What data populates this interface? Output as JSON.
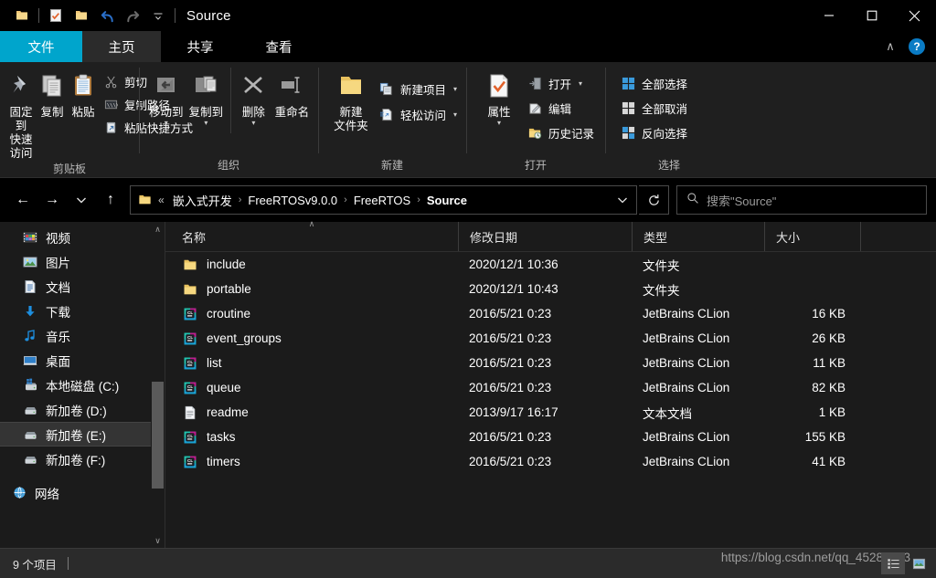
{
  "window": {
    "title": "Source",
    "quick_access": [
      "folder-icon",
      "properties-icon",
      "new-folder-icon",
      "undo-icon",
      "redo-icon",
      "customize-icon"
    ],
    "controls": {
      "minimize": "—",
      "maximize": "□",
      "close": "✕"
    }
  },
  "tabs": [
    {
      "label": "文件",
      "name": "tab-file",
      "state": "file-menu"
    },
    {
      "label": "主页",
      "name": "tab-home",
      "state": "active"
    },
    {
      "label": "共享",
      "name": "tab-share",
      "state": "normal"
    },
    {
      "label": "查看",
      "name": "tab-view",
      "state": "normal"
    }
  ],
  "tab_right": {
    "collapse_ribbon": "∧",
    "help": "?"
  },
  "ribbon": {
    "groups": [
      {
        "title": "剪贴板",
        "big_buttons": [
          {
            "label_line1": "固定到",
            "label_line2": "快速访问",
            "icon": "pin-icon"
          },
          {
            "label_line1": "复制",
            "label_line2": "",
            "icon": "copy-icon"
          },
          {
            "label_line1": "粘贴",
            "label_line2": "",
            "icon": "paste-icon"
          }
        ],
        "small_buttons": [
          {
            "label": "剪切",
            "icon": "scissors-icon"
          },
          {
            "label": "复制路径",
            "icon": "copy-path-icon"
          },
          {
            "label": "粘贴快捷方式",
            "icon": "paste-shortcut-icon"
          }
        ]
      },
      {
        "title": "组织",
        "big_buttons": [
          {
            "label_line1": "移动到",
            "label_line2": "",
            "icon": "move-to-icon",
            "has_caret": true
          },
          {
            "label_line1": "复制到",
            "label_line2": "",
            "icon": "copy-to-icon",
            "has_caret": true
          },
          {
            "label_line1": "删除",
            "label_line2": "",
            "icon": "delete-icon",
            "has_caret": true
          },
          {
            "label_line1": "重命名",
            "label_line2": "",
            "icon": "rename-icon"
          }
        ],
        "small_buttons": []
      },
      {
        "title": "新建",
        "big_buttons": [
          {
            "label_line1": "新建",
            "label_line2": "文件夹",
            "icon": "new-folder-icon"
          }
        ],
        "small_buttons": [
          {
            "label": "新建项目",
            "icon": "new-item-icon",
            "has_caret": true
          },
          {
            "label": "轻松访问",
            "icon": "easy-access-icon",
            "has_caret": true
          }
        ]
      },
      {
        "title": "打开",
        "big_buttons": [
          {
            "label_line1": "属性",
            "label_line2": "",
            "icon": "properties-icon",
            "has_caret": true
          }
        ],
        "small_buttons": [
          {
            "label": "打开",
            "icon": "open-icon",
            "has_caret": true
          },
          {
            "label": "编辑",
            "icon": "edit-icon"
          },
          {
            "label": "历史记录",
            "icon": "history-icon"
          }
        ]
      },
      {
        "title": "选择",
        "big_buttons": [],
        "small_buttons": [
          {
            "label": "全部选择",
            "icon": "select-all-icon"
          },
          {
            "label": "全部取消",
            "icon": "select-none-icon"
          },
          {
            "label": "反向选择",
            "icon": "invert-selection-icon"
          }
        ]
      }
    ]
  },
  "address_bar": {
    "back": "←",
    "forward": "→",
    "recent": "⌄",
    "up": "↑",
    "breadcrumb_overflow": "«",
    "breadcrumbs": [
      "嵌入式开发",
      "FreeRTOSv9.0.0",
      "FreeRTOS",
      "Source"
    ],
    "separator": "›",
    "dropdown": "⌄",
    "refresh": "↻",
    "search_placeholder": "搜索\"Source\""
  },
  "sidebar": {
    "items": [
      {
        "label": "视频",
        "icon": "videos-icon",
        "indent": 1,
        "selected": false
      },
      {
        "label": "图片",
        "icon": "pictures-icon",
        "indent": 1,
        "selected": false
      },
      {
        "label": "文档",
        "icon": "documents-icon",
        "indent": 1,
        "selected": false
      },
      {
        "label": "下载",
        "icon": "downloads-icon",
        "indent": 1,
        "selected": false
      },
      {
        "label": "音乐",
        "icon": "music-icon",
        "indent": 1,
        "selected": false
      },
      {
        "label": "桌面",
        "icon": "desktop-icon",
        "indent": 1,
        "selected": false
      },
      {
        "label": "本地磁盘 (C:)",
        "icon": "system-drive-icon",
        "indent": 1,
        "selected": false
      },
      {
        "label": "新加卷 (D:)",
        "icon": "drive-icon",
        "indent": 1,
        "selected": false
      },
      {
        "label": "新加卷 (E:)",
        "icon": "drive-icon",
        "indent": 1,
        "selected": true
      },
      {
        "label": "新加卷 (F:)",
        "icon": "drive-icon",
        "indent": 1,
        "selected": false
      },
      {
        "label": "网络",
        "icon": "network-icon",
        "indent": 0,
        "selected": false
      }
    ],
    "scroll_up": "∧",
    "scroll_down": "∨"
  },
  "file_list": {
    "columns": [
      {
        "label": "名称",
        "name": "column-name",
        "sorted": true
      },
      {
        "label": "修改日期",
        "name": "column-date-modified",
        "sorted": false
      },
      {
        "label": "类型",
        "name": "column-type",
        "sorted": false
      },
      {
        "label": "大小",
        "name": "column-size",
        "sorted": false
      }
    ],
    "sort_indicator": "∧",
    "rows": [
      {
        "name": "include",
        "date": "2020/12/1 10:36",
        "type": "文件夹",
        "size": "",
        "icon": "folder-icon"
      },
      {
        "name": "portable",
        "date": "2020/12/1 10:43",
        "type": "文件夹",
        "size": "",
        "icon": "folder-icon"
      },
      {
        "name": "croutine",
        "date": "2016/5/21 0:23",
        "type": "JetBrains CLion",
        "size": "16 KB",
        "icon": "clion-file-icon"
      },
      {
        "name": "event_groups",
        "date": "2016/5/21 0:23",
        "type": "JetBrains CLion",
        "size": "26 KB",
        "icon": "clion-file-icon"
      },
      {
        "name": "list",
        "date": "2016/5/21 0:23",
        "type": "JetBrains CLion",
        "size": "11 KB",
        "icon": "clion-file-icon"
      },
      {
        "name": "queue",
        "date": "2016/5/21 0:23",
        "type": "JetBrains CLion",
        "size": "82 KB",
        "icon": "clion-file-icon"
      },
      {
        "name": "readme",
        "date": "2013/9/17 16:17",
        "type": "文本文档",
        "size": "1 KB",
        "icon": "text-file-icon"
      },
      {
        "name": "tasks",
        "date": "2016/5/21 0:23",
        "type": "JetBrains CLion",
        "size": "155 KB",
        "icon": "clion-file-icon"
      },
      {
        "name": "timers",
        "date": "2016/5/21 0:23",
        "type": "JetBrains CLion",
        "size": "41 KB",
        "icon": "clion-file-icon"
      }
    ]
  },
  "status_bar": {
    "item_count": "9 个项目",
    "watermark": "https://blog.csdn.net/qq_45287203"
  },
  "colors": {
    "accent": "#00a5cc",
    "window_bg": "#000000",
    "ribbon_bg": "#1f1f1f",
    "content_bg": "#1b1b1b",
    "status_bg": "#2b2b2b",
    "selection_bg": "#343434",
    "folder_yellow": "#f6d07a",
    "help_blue": "#0a7bc4"
  }
}
